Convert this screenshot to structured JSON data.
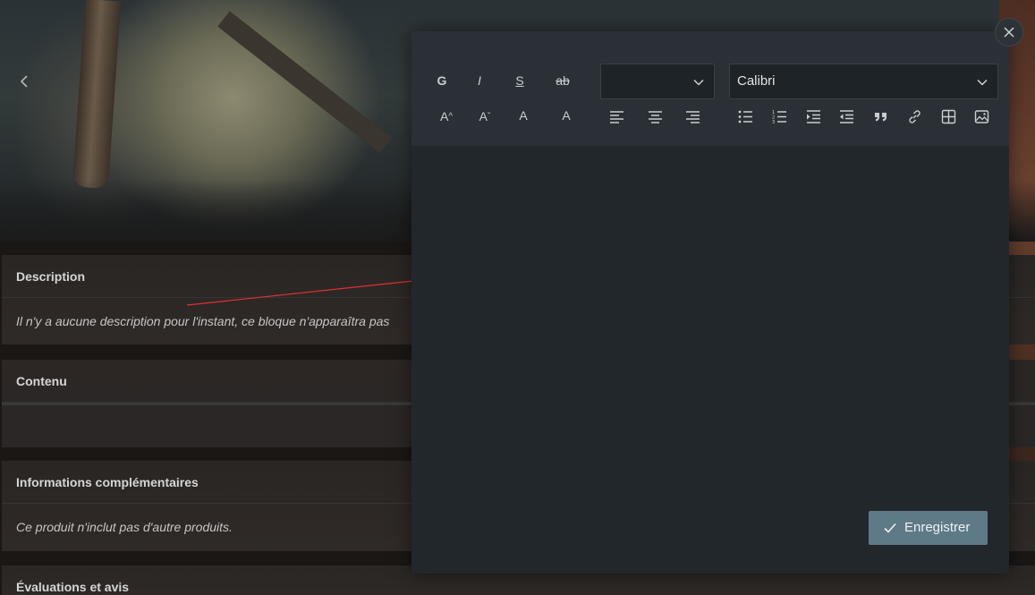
{
  "page": {
    "sections": {
      "description": {
        "title": "Description",
        "text": "Il n'y a aucune description pour l'instant, ce bloque n'apparaîtra pas"
      },
      "contenu": {
        "title": "Contenu"
      },
      "informations": {
        "title": "Informations complémentaires",
        "text": "Ce produit n'inclut pas d'autre produits."
      },
      "evaluations": {
        "title": "Évaluations et avis"
      }
    }
  },
  "editor": {
    "toolbar": {
      "bold": "G",
      "italic": "I",
      "underline": "S",
      "strikethrough": "ab",
      "size_up": "A",
      "size_down": "A",
      "font_color": "A",
      "highlight": "A",
      "heading_select": "",
      "font_select": "Calibri"
    },
    "save_label": "Enregistrer"
  },
  "colors": {
    "modal_bg": "#22272b",
    "toolbar_bg": "#2a3035",
    "save_button": "#5e7a87",
    "annotation_arrow": "#e0322e"
  },
  "icons": [
    "chevron-left-icon",
    "close-icon",
    "chevron-down-icon",
    "align-left-icon",
    "align-center-icon",
    "align-right-icon",
    "bullet-list-icon",
    "numbered-list-icon",
    "indent-icon",
    "outdent-icon",
    "quote-icon",
    "link-icon",
    "table-icon",
    "image-icon",
    "check-icon"
  ]
}
